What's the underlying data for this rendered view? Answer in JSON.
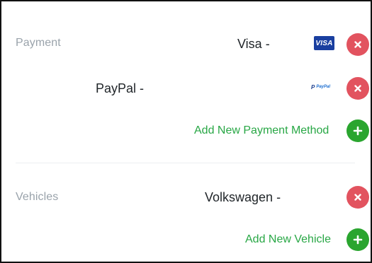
{
  "payment": {
    "label": "Payment",
    "items": [
      {
        "name": "Visa -",
        "logo_text": "VISA",
        "remove_icon": "close-icon"
      },
      {
        "name": "PayPal -",
        "logo_mark": "P",
        "logo_text": "PayPal",
        "remove_icon": "close-icon"
      }
    ],
    "add_label": "Add New Payment Method",
    "add_icon": "plus-icon"
  },
  "vehicles": {
    "label": "Vehicles",
    "items": [
      {
        "name": "Volkswagen -",
        "remove_icon": "close-icon"
      }
    ],
    "add_label": "Add New Vehicle",
    "add_icon": "plus-icon"
  },
  "colors": {
    "remove": "#e2535f",
    "add": "#2aa52f",
    "add_text": "#28a745",
    "section_label": "#9aa3ab",
    "visa_bg": "#1a3fa0"
  }
}
